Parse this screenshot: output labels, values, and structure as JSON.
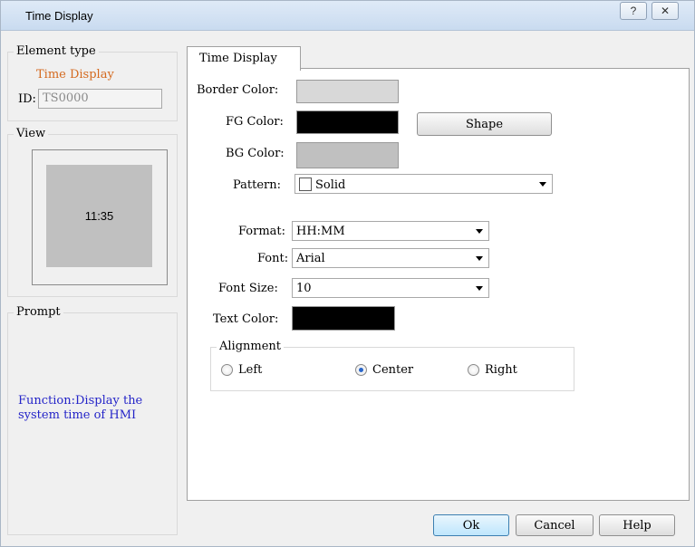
{
  "window": {
    "title": "Time Display",
    "help_glyph": "?",
    "close_glyph": "✕"
  },
  "element_type": {
    "group_title": "Element type",
    "value": "Time Display",
    "id_label": "ID:",
    "id_value": "TS0000"
  },
  "view": {
    "group_title": "View",
    "preview_text": "11:35",
    "preview_bg": "#c0c0c0"
  },
  "prompt": {
    "group_title": "Prompt",
    "text": "Function:Display the system time of HMI"
  },
  "tab": {
    "label": "Time Display"
  },
  "form": {
    "border_color_label": "Border Color:",
    "border_color": "#d8d8d8",
    "fg_color_label": "FG Color:",
    "fg_color": "#000000",
    "bg_color_label": "BG Color:",
    "bg_color": "#c0c0c0",
    "shape_button": "Shape",
    "pattern_label": "Pattern:",
    "pattern_value": "Solid",
    "format_label": "Format:",
    "format_value": "HH:MM",
    "font_label": "Font:",
    "font_value": "Arial",
    "font_size_label": "Font Size:",
    "font_size_value": "10",
    "text_color_label": "Text Color:",
    "text_color": "#000000"
  },
  "alignment": {
    "group_title": "Alignment",
    "options": [
      "Left",
      "Center",
      "Right"
    ],
    "selected": "Center"
  },
  "footer": {
    "ok": "Ok",
    "cancel": "Cancel",
    "help": "Help"
  }
}
